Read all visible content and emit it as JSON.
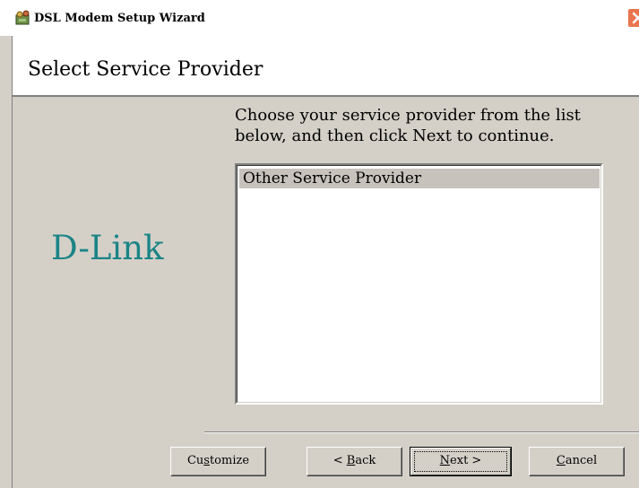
{
  "window": {
    "title": "DSL Modem Setup Wizard"
  },
  "header": {
    "title": "Select Service Provider"
  },
  "logo": {
    "text": "D-Link",
    "color": "#1b8486"
  },
  "instructions": {
    "text": "Choose your service provider from the list below, and then click Next to continue."
  },
  "provider_list": {
    "items": [
      {
        "label": "Other Service Provider",
        "selected": true
      }
    ]
  },
  "buttons": {
    "customize": {
      "pre": "Cu",
      "key": "s",
      "post": "tomize"
    },
    "back": {
      "pre": "< ",
      "key": "B",
      "post": "ack"
    },
    "next": {
      "pre": "",
      "key": "N",
      "post": "ext >"
    },
    "cancel": {
      "pre": "",
      "key": "C",
      "post": "ancel"
    }
  },
  "icons": {
    "app": "wizard-app-icon",
    "close": "close-icon"
  },
  "colors": {
    "dialog_bg": "#d4d0c8",
    "close_button": "#e8754f",
    "selection": "#c7c3bc"
  }
}
